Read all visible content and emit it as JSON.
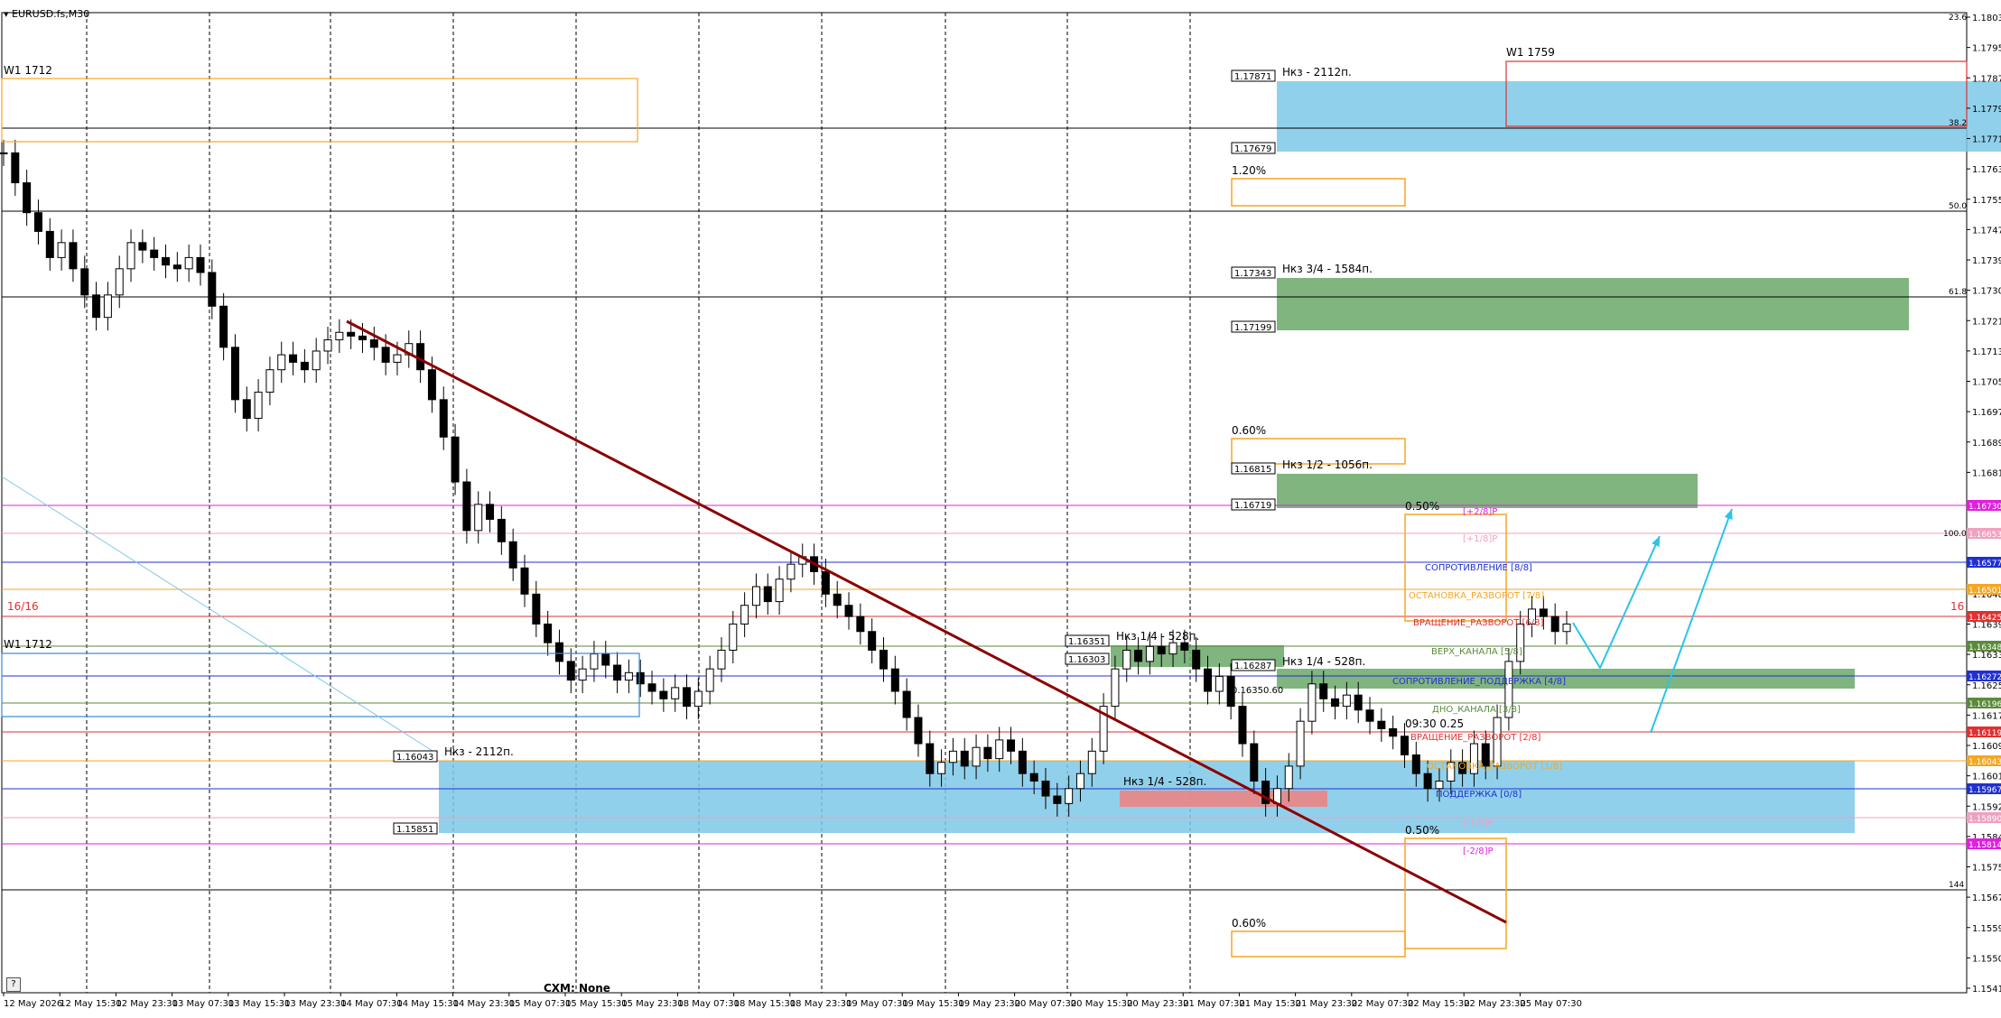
{
  "window": {
    "symbol_label": "EURUSD.fs,M30",
    "broker_label": "CXM: None",
    "help_label": "?"
  },
  "chart_data": {
    "type": "candlestick",
    "symbol": "EURUSD.fs",
    "timeframe": "M30",
    "ylim": [
      1.15414,
      1.18035
    ],
    "y_ticks": [
      "1.18035",
      "1.17955",
      "1.17875",
      "1.17795",
      "1.17715",
      "1.17635",
      "1.17555",
      "1.17470",
      "1.17390",
      "1.17300",
      "1.17215",
      "1.17135",
      "1.17050",
      "1.16970",
      "1.16890",
      "1.16810",
      "1.16725",
      "1.16645",
      "1.16560",
      "1.16480",
      "1.16395",
      "1.16330",
      "1.16250",
      "1.16170",
      "1.16090",
      "1.16010",
      "1.15925",
      "1.15840",
      "1.15755",
      "1.15675",
      "1.15590",
      "1.15500",
      "1.15414"
    ],
    "x_ticks": [
      "12 May 2026",
      "12 May 15:30",
      "12 May 23:30",
      "13 May 07:30",
      "13 May 15:30",
      "13 May 23:30",
      "14 May 07:30",
      "14 May 15:30",
      "14 May 23:30",
      "15 May 07:30",
      "15 May 15:30",
      "15 May 23:30",
      "18 May 07:30",
      "18 May 15:30",
      "18 May 23:30",
      "19 May 07:30",
      "19 May 15:30",
      "19 May 23:30",
      "20 May 07:30",
      "20 May 15:30",
      "20 May 23:30",
      "21 May 07:30",
      "21 May 15:30",
      "21 May 23:30",
      "22 May 07:30",
      "22 May 15:30",
      "22 May 23:30",
      "25 May 07:30"
    ],
    "close_path": [
      1.1766,
      1.1758,
      1.175,
      1.1745,
      1.1738,
      1.1742,
      1.1735,
      1.1728,
      1.1722,
      1.1728,
      1.1735,
      1.1742,
      1.174,
      1.1738,
      1.1736,
      1.1735,
      1.1738,
      1.1734,
      1.1725,
      1.1714,
      1.17,
      1.1695,
      1.1702,
      1.1708,
      1.1712,
      1.171,
      1.1708,
      1.1713,
      1.1716,
      1.1718,
      1.1717,
      1.1716,
      1.1714,
      1.171,
      1.1712,
      1.1715,
      1.1708,
      1.17,
      1.169,
      1.1678,
      1.1665,
      1.1672,
      1.1668,
      1.1662,
      1.1655,
      1.1648,
      1.164,
      1.1635,
      1.163,
      1.1625,
      1.1628,
      1.1632,
      1.1629,
      1.1625,
      1.1627,
      1.1624,
      1.1622,
      1.162,
      1.1623,
      1.1618,
      1.1622,
      1.1628,
      1.1633,
      1.164,
      1.1645,
      1.165,
      1.1646,
      1.1652,
      1.1656,
      1.1658,
      1.1654,
      1.1648,
      1.1645,
      1.1642,
      1.1638,
      1.1633,
      1.1628,
      1.1622,
      1.1615,
      1.1608,
      1.16,
      1.1603,
      1.1606,
      1.1602,
      1.1607,
      1.1604,
      1.1609,
      1.1606,
      1.16,
      1.1598,
      1.1594,
      1.1592,
      1.1596,
      1.16,
      1.1606,
      1.1618,
      1.1628,
      1.1633,
      1.163,
      1.1634,
      1.1632,
      1.1635,
      1.1633,
      1.1628,
      1.1622,
      1.1626,
      1.1618,
      1.1608,
      1.1598,
      1.1592,
      1.1596,
      1.1602,
      1.1614,
      1.1624,
      1.162,
      1.1618,
      1.1621,
      1.1617,
      1.1614,
      1.1612,
      1.161,
      1.1605,
      1.16,
      1.1596,
      1.1598,
      1.1603,
      1.16,
      1.1608,
      1.1602,
      1.1615,
      1.163,
      1.164,
      1.1644,
      1.1642,
      1.1638,
      1.164
    ],
    "series": [
      {
        "name": "W1 1712",
        "color": "#f5a623",
        "kind": "zone"
      },
      {
        "name": "W1 1759",
        "color": "#e03030",
        "kind": "zone"
      }
    ],
    "zones": [
      {
        "upper": "1.17871",
        "lower": "1.17679",
        "label": "Нкз - 2112п.",
        "color": "#7ec8e8"
      },
      {
        "upper": "1.17343",
        "lower": "1.17199",
        "label": "Нкз 3/4 - 1584п.",
        "color": "#6aa86a"
      },
      {
        "upper": "1.16815",
        "lower": "1.16719",
        "label": "Нкз 1/2 - 1056п.",
        "color": "#6aa86a"
      },
      {
        "upper": "1.16351",
        "lower": "1.16303",
        "label": "Нкз 1/4 - 528п.",
        "color": "#6aa86a"
      },
      {
        "upper": "1.16287",
        "lower": "",
        "label": "Нкз 1/4 - 528п.",
        "color": "#6aa86a"
      },
      {
        "upper": "1.16043",
        "lower": "1.15851",
        "label": "Нкз - 2112п.",
        "color": "#7ec8e8"
      },
      {
        "upper": "",
        "lower": "",
        "label": "Нкз 1/4 - 528п.",
        "color": "#f08080"
      }
    ],
    "murrey_levels": [
      {
        "label": "[+2/8]P",
        "price": "1.16730",
        "color": "#e020e0"
      },
      {
        "label": "[+1/8]P",
        "price": "1.16653",
        "color": "#f0a0c0"
      },
      {
        "label": "СОПРОТИВЛЕНИЕ [8/8]",
        "price": "1.16577",
        "color": "#2030d0"
      },
      {
        "label": "ОСТАНОВКА_РАЗВОРОТ [7/8]",
        "price": "1.16501",
        "color": "#f5a623"
      },
      {
        "label": "ВРАЩЕНИЕ_РАЗВОРОТ [6/8]",
        "price": "1.16425",
        "color": "#e03030"
      },
      {
        "label": "ВЕРХ_КАНАЛА [5/8]",
        "price": "1.16348",
        "color": "#5a8a3a"
      },
      {
        "label": "СОПРОТИВЛЕНИЕ_ПОДДЕРЖКА [4/8]",
        "price": "1.16272",
        "color": "#2030d0"
      },
      {
        "label": "ДНО_КАНАЛА [3/8]",
        "price": "1.16196",
        "color": "#5a8a3a"
      },
      {
        "label": "ВРАЩЕНИЕ_РАЗВОРОТ [2/8]",
        "price": "1.16119",
        "color": "#e03030"
      },
      {
        "label": "ОСТАНОВКА_РАЗВОРОТ [1/8]",
        "price": "1.16043",
        "color": "#f5a623"
      },
      {
        "label": "ПОДДЕРЖКА [0/8]",
        "price": "1.15967",
        "color": "#2030d0"
      },
      {
        "label": "[-1/8]P",
        "price": "1.15890",
        "color": "#f0a0c0"
      },
      {
        "label": "[-2/8]P",
        "price": "1.15814",
        "color": "#e020e0"
      }
    ],
    "annotations": {
      "w1_top": "W1 1712",
      "w1_right": "W1 1759",
      "w1_mid": "W1 1712",
      "pct_120": "1.20%",
      "pct_060_top": "0.60%",
      "pct_050_top": "0.50%",
      "pct_050_bottom": "0.50%",
      "pct_060_bottom": "0.60%",
      "time_pct": "09:30 0.25",
      "left_1616": "16/16",
      "right_16": "16",
      "fib_236": "23.6",
      "fib_382": "38.2",
      "fib_500": "50.0",
      "fib_618": "61.8",
      "fib_100": "100.0",
      "fib_144": "144",
      "small_overlap": "0.16350.60"
    },
    "colors": {
      "trendline": "#8b0000",
      "arrow": "#29c5e6",
      "fib_line": "#000000"
    }
  }
}
